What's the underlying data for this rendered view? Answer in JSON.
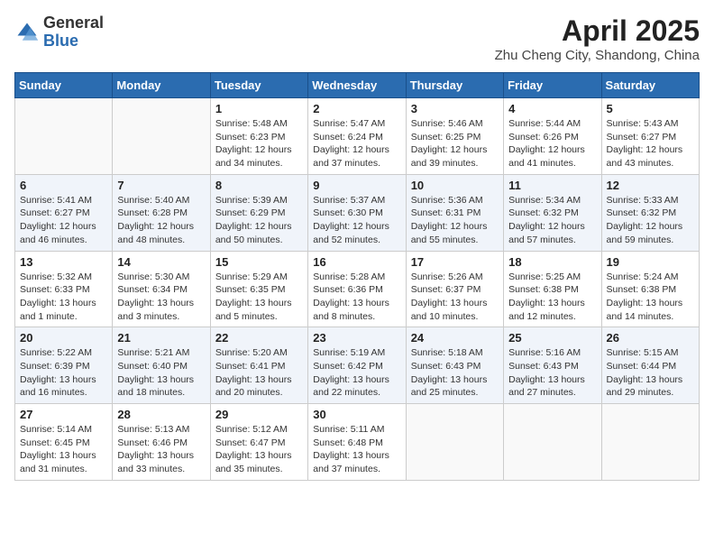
{
  "header": {
    "logo_general": "General",
    "logo_blue": "Blue",
    "month_year": "April 2025",
    "location": "Zhu Cheng City, Shandong, China"
  },
  "days_of_week": [
    "Sunday",
    "Monday",
    "Tuesday",
    "Wednesday",
    "Thursday",
    "Friday",
    "Saturday"
  ],
  "weeks": [
    [
      {
        "day": "",
        "info": ""
      },
      {
        "day": "",
        "info": ""
      },
      {
        "day": "1",
        "info": "Sunrise: 5:48 AM\nSunset: 6:23 PM\nDaylight: 12 hours and 34 minutes."
      },
      {
        "day": "2",
        "info": "Sunrise: 5:47 AM\nSunset: 6:24 PM\nDaylight: 12 hours and 37 minutes."
      },
      {
        "day": "3",
        "info": "Sunrise: 5:46 AM\nSunset: 6:25 PM\nDaylight: 12 hours and 39 minutes."
      },
      {
        "day": "4",
        "info": "Sunrise: 5:44 AM\nSunset: 6:26 PM\nDaylight: 12 hours and 41 minutes."
      },
      {
        "day": "5",
        "info": "Sunrise: 5:43 AM\nSunset: 6:27 PM\nDaylight: 12 hours and 43 minutes."
      }
    ],
    [
      {
        "day": "6",
        "info": "Sunrise: 5:41 AM\nSunset: 6:27 PM\nDaylight: 12 hours and 46 minutes."
      },
      {
        "day": "7",
        "info": "Sunrise: 5:40 AM\nSunset: 6:28 PM\nDaylight: 12 hours and 48 minutes."
      },
      {
        "day": "8",
        "info": "Sunrise: 5:39 AM\nSunset: 6:29 PM\nDaylight: 12 hours and 50 minutes."
      },
      {
        "day": "9",
        "info": "Sunrise: 5:37 AM\nSunset: 6:30 PM\nDaylight: 12 hours and 52 minutes."
      },
      {
        "day": "10",
        "info": "Sunrise: 5:36 AM\nSunset: 6:31 PM\nDaylight: 12 hours and 55 minutes."
      },
      {
        "day": "11",
        "info": "Sunrise: 5:34 AM\nSunset: 6:32 PM\nDaylight: 12 hours and 57 minutes."
      },
      {
        "day": "12",
        "info": "Sunrise: 5:33 AM\nSunset: 6:32 PM\nDaylight: 12 hours and 59 minutes."
      }
    ],
    [
      {
        "day": "13",
        "info": "Sunrise: 5:32 AM\nSunset: 6:33 PM\nDaylight: 13 hours and 1 minute."
      },
      {
        "day": "14",
        "info": "Sunrise: 5:30 AM\nSunset: 6:34 PM\nDaylight: 13 hours and 3 minutes."
      },
      {
        "day": "15",
        "info": "Sunrise: 5:29 AM\nSunset: 6:35 PM\nDaylight: 13 hours and 5 minutes."
      },
      {
        "day": "16",
        "info": "Sunrise: 5:28 AM\nSunset: 6:36 PM\nDaylight: 13 hours and 8 minutes."
      },
      {
        "day": "17",
        "info": "Sunrise: 5:26 AM\nSunset: 6:37 PM\nDaylight: 13 hours and 10 minutes."
      },
      {
        "day": "18",
        "info": "Sunrise: 5:25 AM\nSunset: 6:38 PM\nDaylight: 13 hours and 12 minutes."
      },
      {
        "day": "19",
        "info": "Sunrise: 5:24 AM\nSunset: 6:38 PM\nDaylight: 13 hours and 14 minutes."
      }
    ],
    [
      {
        "day": "20",
        "info": "Sunrise: 5:22 AM\nSunset: 6:39 PM\nDaylight: 13 hours and 16 minutes."
      },
      {
        "day": "21",
        "info": "Sunrise: 5:21 AM\nSunset: 6:40 PM\nDaylight: 13 hours and 18 minutes."
      },
      {
        "day": "22",
        "info": "Sunrise: 5:20 AM\nSunset: 6:41 PM\nDaylight: 13 hours and 20 minutes."
      },
      {
        "day": "23",
        "info": "Sunrise: 5:19 AM\nSunset: 6:42 PM\nDaylight: 13 hours and 22 minutes."
      },
      {
        "day": "24",
        "info": "Sunrise: 5:18 AM\nSunset: 6:43 PM\nDaylight: 13 hours and 25 minutes."
      },
      {
        "day": "25",
        "info": "Sunrise: 5:16 AM\nSunset: 6:43 PM\nDaylight: 13 hours and 27 minutes."
      },
      {
        "day": "26",
        "info": "Sunrise: 5:15 AM\nSunset: 6:44 PM\nDaylight: 13 hours and 29 minutes."
      }
    ],
    [
      {
        "day": "27",
        "info": "Sunrise: 5:14 AM\nSunset: 6:45 PM\nDaylight: 13 hours and 31 minutes."
      },
      {
        "day": "28",
        "info": "Sunrise: 5:13 AM\nSunset: 6:46 PM\nDaylight: 13 hours and 33 minutes."
      },
      {
        "day": "29",
        "info": "Sunrise: 5:12 AM\nSunset: 6:47 PM\nDaylight: 13 hours and 35 minutes."
      },
      {
        "day": "30",
        "info": "Sunrise: 5:11 AM\nSunset: 6:48 PM\nDaylight: 13 hours and 37 minutes."
      },
      {
        "day": "",
        "info": ""
      },
      {
        "day": "",
        "info": ""
      },
      {
        "day": "",
        "info": ""
      }
    ]
  ]
}
